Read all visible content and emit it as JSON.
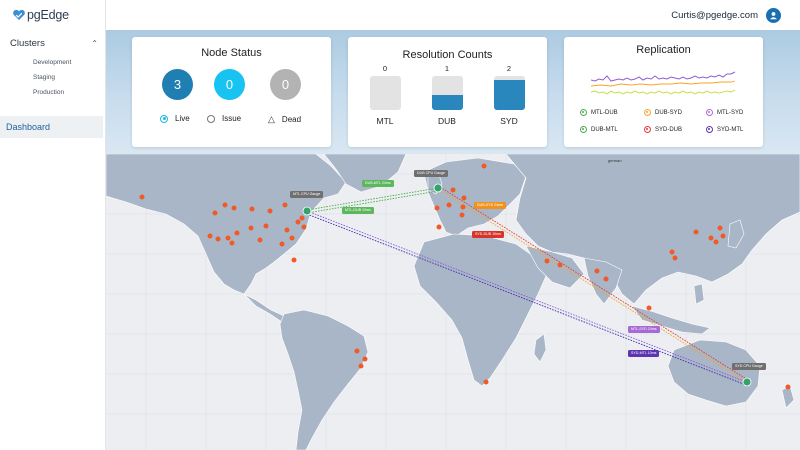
{
  "brand": {
    "name": "pgEdge"
  },
  "sidebar": {
    "section": "Clusters",
    "items": [
      "Development",
      "Staging",
      "Production"
    ],
    "active": "Dashboard"
  },
  "header": {
    "user_email": "Curtis@pgedge.com"
  },
  "node_status": {
    "title": "Node Status",
    "live": {
      "count": "3",
      "label": "Live",
      "color": "#1f7fb2"
    },
    "issue": {
      "count": "0",
      "label": "Issue",
      "color": "#17c3f1"
    },
    "dead": {
      "count": "0",
      "label": "Dead",
      "color": "#b3b3b3"
    }
  },
  "resolution_counts": {
    "title": "Resolution Counts",
    "bars": [
      {
        "label": "MTL",
        "value": "0",
        "fill": 0.0
      },
      {
        "label": "DUB",
        "value": "1",
        "fill": 0.45
      },
      {
        "label": "SYD",
        "value": "2",
        "fill": 0.88
      }
    ],
    "bar_color": "#2a87bd"
  },
  "replication": {
    "title": "Replication",
    "legend": [
      {
        "label": "MTL-DUB",
        "color": "#4caf50"
      },
      {
        "label": "DUB-SYD",
        "color": "#f5a623"
      },
      {
        "label": "MTL-SYD",
        "color": "#b36bd6"
      },
      {
        "label": "DUB-MTL",
        "color": "#4caf50"
      },
      {
        "label": "SYD-DUB",
        "color": "#e53935"
      },
      {
        "label": "SYD-MTL",
        "color": "#5e35b1"
      }
    ]
  },
  "map": {
    "caption": "german",
    "nodes": [
      {
        "name": "MTL",
        "color": "#2fa56a"
      },
      {
        "name": "DUB",
        "color": "#2fa56a"
      },
      {
        "name": "SYD",
        "color": "#2fa56a"
      }
    ],
    "gauge_labels": [
      "MTL CPU Gauge",
      "DUB CPU Gauge",
      "SYD CPU Gauge"
    ],
    "link_labels": [
      {
        "text": "DUB-MTL 24ms",
        "color": "#5cb85c"
      },
      {
        "text": "MTL-DUB 10ms",
        "color": "#5cb85c"
      },
      {
        "text": "DUB-SYD 24ms",
        "color": "#f0931e"
      },
      {
        "text": "SYD-DUB 10ms",
        "color": "#d9342b"
      },
      {
        "text": "MTL-SYD 24ms",
        "color": "#a66ad6"
      },
      {
        "text": "SYD-MTL 10ms",
        "color": "#5e35b1"
      }
    ],
    "point_color": "#f05a28"
  }
}
